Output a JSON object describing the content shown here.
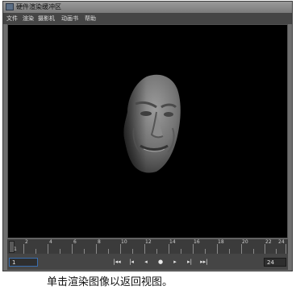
{
  "window": {
    "title": "硬件渲染缓冲区"
  },
  "menu": [
    "文件",
    "渲染",
    "摄影机",
    "动画书",
    "帮助"
  ],
  "timeline": {
    "ticks": [
      "2",
      "4",
      "6",
      "8",
      "10",
      "12",
      "14",
      "16",
      "18",
      "20",
      "22",
      "24"
    ],
    "current_frame_marker": "1"
  },
  "controls": {
    "current_frame": "1",
    "end_frame": "24",
    "buttons": [
      {
        "name": "go-to-start-icon",
        "glyph": "|◂◂"
      },
      {
        "name": "step-back-icon",
        "glyph": "|◂"
      },
      {
        "name": "play-backward-icon",
        "glyph": "◂"
      },
      {
        "name": "stop-icon",
        "glyph": "●"
      },
      {
        "name": "play-forward-icon",
        "glyph": "▸"
      },
      {
        "name": "step-forward-icon",
        "glyph": "▸|"
      },
      {
        "name": "go-to-end-icon",
        "glyph": "▸▸|"
      }
    ]
  },
  "caption": "单击渲染图像以返回视图。"
}
